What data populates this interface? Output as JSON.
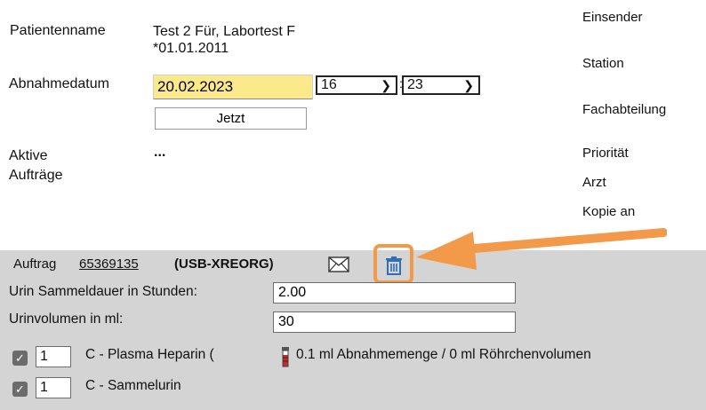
{
  "patient": {
    "name_label": "Patientenname",
    "name_value": "Test 2 Für, Labortest F",
    "birthdate": "*01.01.2011",
    "date_label": "Abnahmedatum",
    "date_value": "20.02.2023",
    "hour_value": "16",
    "minute_value": "23",
    "now_button": "Jetzt",
    "active_orders_label_1": "Aktive",
    "active_orders_label_2": "Aufträge",
    "active_orders_value": "..."
  },
  "right_labels": {
    "sender": "Einsender",
    "ward": "Station",
    "department": "Fachabteilung",
    "priority": "Priorität",
    "doctor": "Arzt",
    "copy_to": "Kopie an"
  },
  "order": {
    "prefix": "Auftrag",
    "number": "65369135",
    "code": "(USB-XREORG)",
    "collection_duration_label": "Urin Sammeldauer in Stunden:",
    "collection_duration_value": "2.00",
    "urine_volume_label": "Urinvolumen in ml:",
    "urine_volume_value": "30",
    "items": [
      {
        "checked": true,
        "qty": "1",
        "label": "C - Plasma Heparin (",
        "detail": "0.1 ml Abnahmemenge / 0 ml Röhrchenvolumen"
      },
      {
        "checked": true,
        "qty": "1",
        "label": "C - Sammelurin"
      }
    ]
  },
  "colors": {
    "highlight_orange": "#f29a4a",
    "date_field_yellow": "#fbe98a",
    "panel_gray": "#d4d4d4",
    "trash_blue": "#2f6fb7"
  },
  "icons": {
    "mail": "envelope-icon",
    "delete": "trash-icon",
    "tube": "blood-tube-icon"
  }
}
